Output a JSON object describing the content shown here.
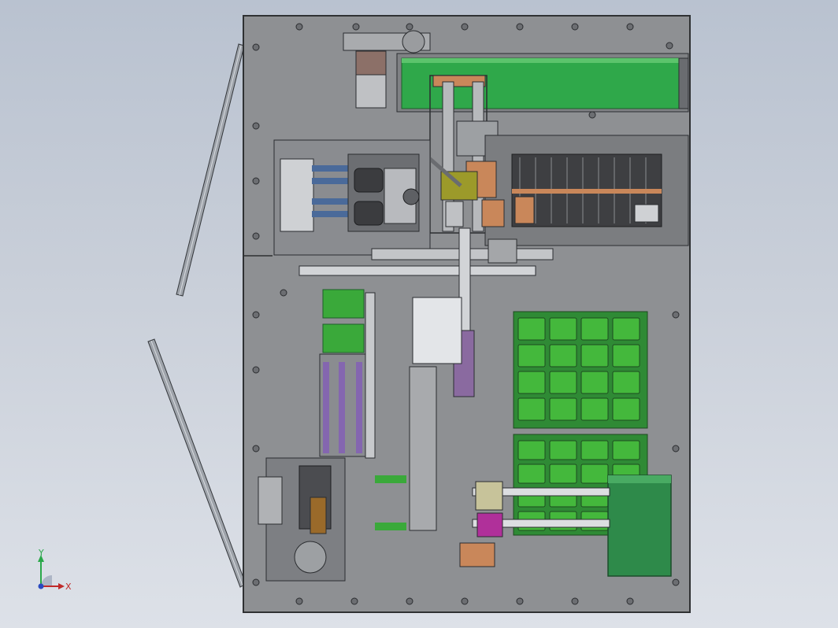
{
  "viewport": {
    "background_top": "#b9c2d0",
    "background_bottom": "#dde1e8"
  },
  "colors": {
    "plate": "#8e9093",
    "plate_edge": "#2f3133",
    "conveyor_green": "#2fa84a",
    "tray_green": "#3aa93a",
    "copper": "#c9875a",
    "olive": "#9c9a2a",
    "magenta": "#b0309a",
    "brown": "#9a6a2a",
    "purple": "#8466b0",
    "motor_green": "#2e8a4a"
  },
  "triad": {
    "x_label": "X",
    "y_label": "Y",
    "z_icon": "z-axis-dot-icon"
  }
}
